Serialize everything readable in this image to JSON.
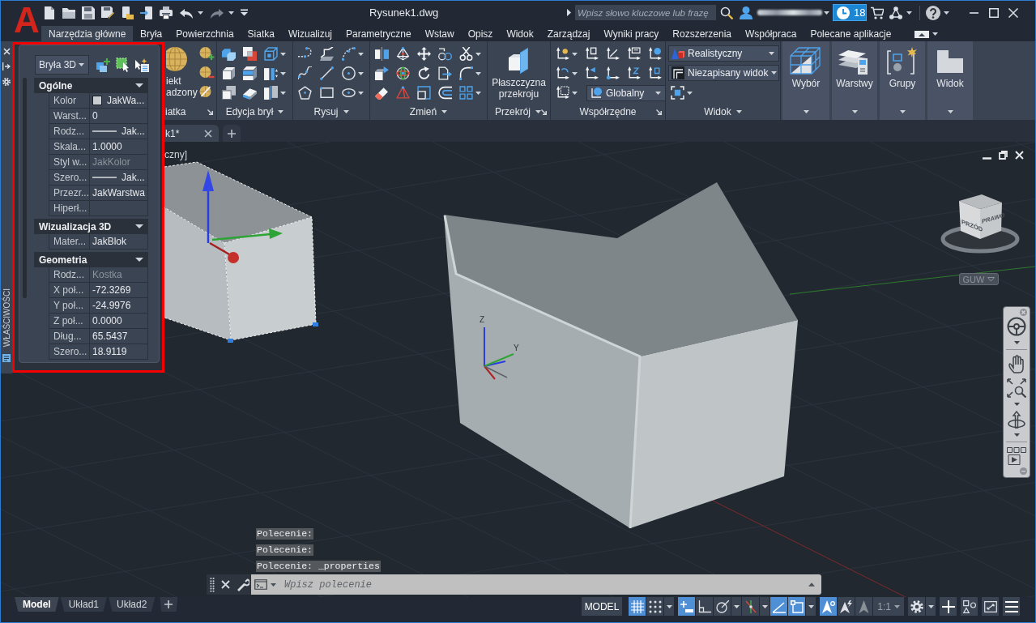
{
  "app_logo": "A",
  "title_bar": {
    "title": "Rysunek1.dwg",
    "search_placeholder": "Wpisz słowo kluczowe lub frazę",
    "trial_days": "18"
  },
  "ribbon_tabs": [
    {
      "label": "Narzędzia główne",
      "selected": true
    },
    {
      "label": "Bryła",
      "selected": false
    },
    {
      "label": "Powierzchnia",
      "selected": false
    },
    {
      "label": "Siatka",
      "selected": false
    },
    {
      "label": "Wizualizuj",
      "selected": false
    },
    {
      "label": "Parametryczne",
      "selected": false
    },
    {
      "label": "Wstaw",
      "selected": false
    },
    {
      "label": "Opisz",
      "selected": false
    },
    {
      "label": "Widok",
      "selected": false
    },
    {
      "label": "Zarządzaj",
      "selected": false
    },
    {
      "label": "Wyniki pracy",
      "selected": false
    },
    {
      "label": "Rozszerzenia",
      "selected": false
    },
    {
      "label": "Współpraca",
      "selected": false
    },
    {
      "label": "Polecane aplikacje",
      "selected": false
    }
  ],
  "ribbon_panels": [
    {
      "kind": "mesh",
      "title": "iatka",
      "menu": false,
      "launcher": true,
      "button_label": [
        "iekt",
        "adzony"
      ]
    },
    {
      "kind": "solid_editing",
      "title": "Edycja brył",
      "menu": true,
      "launcher": false
    },
    {
      "kind": "draw",
      "title": "Rysuj",
      "menu": true,
      "launcher": false
    },
    {
      "kind": "modify",
      "title": "Zmień",
      "menu": true,
      "launcher": false
    },
    {
      "kind": "section",
      "title": "Przekrój",
      "menu": true,
      "launcher": true,
      "button_label": [
        "Płaszczyzna",
        "przekroju"
      ]
    },
    {
      "kind": "coordinates",
      "title": "Współrzędne",
      "menu": false,
      "launcher": true,
      "dropdown": "Globalny"
    },
    {
      "kind": "view",
      "title": "Widok",
      "menu": true,
      "launcher": false,
      "dropdowns": [
        "Realistyczny",
        "Niezapisany widok"
      ]
    },
    {
      "kind": "selection",
      "label": "Wybór"
    },
    {
      "kind": "layers",
      "label": "Warstwy"
    },
    {
      "kind": "groups",
      "label": "Grupy"
    },
    {
      "kind": "views",
      "label": "Widok"
    }
  ],
  "file_tabs": [
    {
      "label": "k1*",
      "selected": true
    }
  ],
  "properties_palette": {
    "title": "WŁAŚCIWOŚCI",
    "object_type": "Bryła 3D",
    "categories": [
      {
        "name": "Ogólne",
        "expanded": true,
        "rows": [
          {
            "label": "Kolor",
            "value": "JakWa...",
            "kind": "color",
            "disabled": false
          },
          {
            "label": "Warst...",
            "value": "0",
            "kind": "text",
            "disabled": false
          },
          {
            "label": "Rodz...",
            "value": "Jak...",
            "kind": "linetype",
            "disabled": false
          },
          {
            "label": "Skala...",
            "value": "1.0000",
            "kind": "text",
            "disabled": false
          },
          {
            "label": "Styl w...",
            "value": "JakKolor",
            "kind": "text",
            "disabled": true
          },
          {
            "label": "Szero...",
            "value": "Jak...",
            "kind": "linetype",
            "disabled": false
          },
          {
            "label": "Przezr...",
            "value": "JakWarstwa",
            "kind": "text",
            "disabled": false
          },
          {
            "label": "Hiperł...",
            "kind": "text",
            "disabled": false
          }
        ]
      },
      {
        "name": "Wizualizacja 3D",
        "expanded": true,
        "rows": [
          {
            "label": "Mater...",
            "value": "JakBlok",
            "kind": "text",
            "disabled": false
          }
        ]
      },
      {
        "name": "Geometria",
        "expanded": true,
        "rows": [
          {
            "label": "Rodz...",
            "value": "Kostka",
            "kind": "text",
            "disabled": true
          },
          {
            "label": "X poł...",
            "value": "-72.3269",
            "kind": "text",
            "disabled": false
          },
          {
            "label": "Y poł...",
            "value": "-24.9976",
            "kind": "text",
            "disabled": false
          },
          {
            "label": "Z poł...",
            "value": "0.0000",
            "kind": "text",
            "disabled": false
          },
          {
            "label": "Dług...",
            "value": "65.5437",
            "kind": "text",
            "disabled": false
          },
          {
            "label": "Szero...",
            "value": "18.9119",
            "kind": "text",
            "disabled": false
          }
        ]
      }
    ]
  },
  "viewport": {
    "label": "czny]",
    "viewcube_faces": [
      "PRZÓD",
      "PRAWO"
    ],
    "ucs_menu": "GUW",
    "ucs_labels": [
      "Z",
      "Y"
    ]
  },
  "command_line": {
    "history": [
      "Polecenie:",
      "Polecenie:",
      "Polecenie: _properties"
    ],
    "placeholder": "Wpisz polecenie"
  },
  "layout_tabs": [
    {
      "label": "Model",
      "selected": true
    },
    {
      "label": "Układ1",
      "selected": false
    },
    {
      "label": "Układ2",
      "selected": false
    }
  ],
  "status_bar": {
    "model": "MODEL",
    "toggles": [
      {
        "kind": "grid",
        "on": true,
        "menu": false
      },
      {
        "kind": "snap",
        "on": false,
        "menu": true
      },
      {
        "kind": "infer",
        "on": true,
        "menu": false
      },
      {
        "kind": "ortho",
        "on": false,
        "menu": false
      },
      {
        "kind": "polar",
        "on": false,
        "menu": true
      },
      {
        "kind": "isodraft",
        "on": false,
        "menu": true
      },
      {
        "kind": "tracking",
        "on": true,
        "menu": false
      },
      {
        "kind": "osnap",
        "on": true,
        "menu": true
      },
      {
        "kind": "annotation_visibility",
        "on": true,
        "menu": false
      },
      {
        "kind": "autoscale",
        "on": false,
        "menu": false
      }
    ],
    "annotation_scale": "1:1"
  }
}
